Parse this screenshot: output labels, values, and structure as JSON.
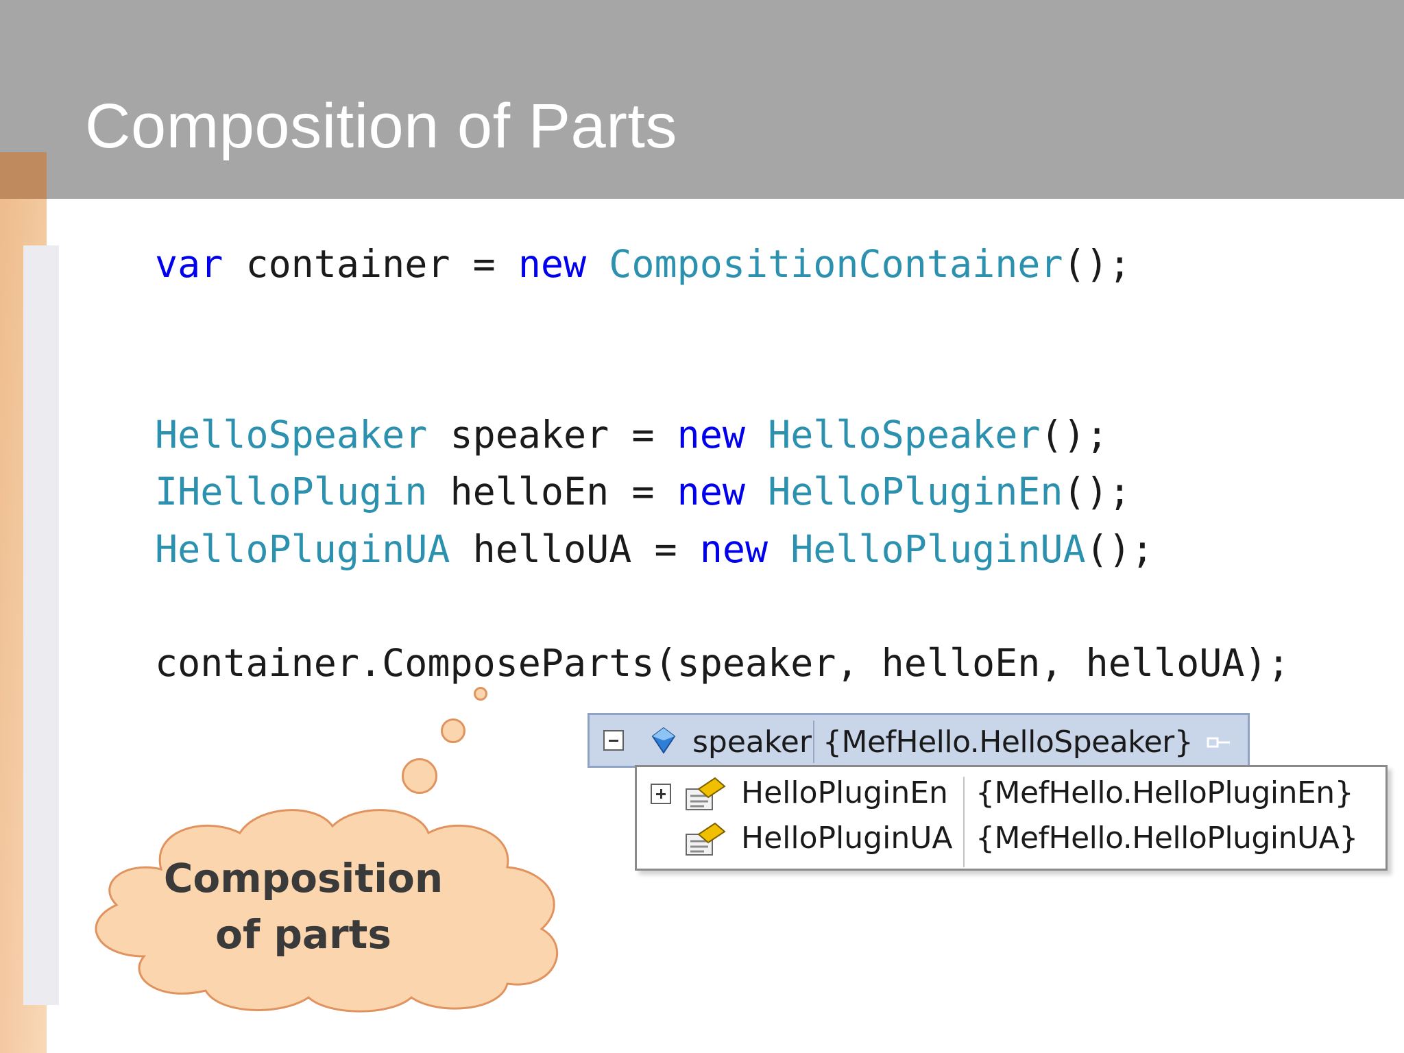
{
  "slide": {
    "title": "Composition of Parts"
  },
  "code": {
    "line1": {
      "kw_var": "var",
      "text1": " container = ",
      "kw_new": "new",
      "text2": " ",
      "type": "CompositionContainer",
      "text3": "();"
    },
    "line2": {
      "type1": "HelloSpeaker",
      "text1": " speaker = ",
      "kw_new": "new",
      "text2": " ",
      "type2": "HelloSpeaker",
      "text3": "();"
    },
    "line3": {
      "type1": "IHelloPlugin",
      "text1": " helloEn = ",
      "kw_new": "new",
      "text2": " ",
      "type2": "HelloPluginEn",
      "text3": "();"
    },
    "line4": {
      "type1": "HelloPluginUA",
      "text1": " helloUA = ",
      "kw_new": "new",
      "text2": " ",
      "type2": "HelloPluginUA",
      "text3": "();"
    },
    "line5": "container.ComposeParts(speaker, helloEn, helloUA);"
  },
  "callout": {
    "line1": "Composition",
    "line2": "of parts"
  },
  "debugger_tip": {
    "name": "speaker",
    "value": "{MefHello.HelloSpeaker}",
    "icon": "field-icon",
    "children": [
      {
        "name": "HelloPluginEn",
        "value": "{MefHello.HelloPluginEn}",
        "icon": "property-icon",
        "expandable": true
      },
      {
        "name": "HelloPluginUA",
        "value": "{MefHello.HelloPluginUA}",
        "icon": "property-icon",
        "expandable": false
      }
    ]
  },
  "colors": {
    "header": "#a6a6a6",
    "keyword": "#0000ee",
    "type": "#2b91af",
    "cloud_fill": "#fbd5ad",
    "cloud_stroke": "#e0935f"
  }
}
